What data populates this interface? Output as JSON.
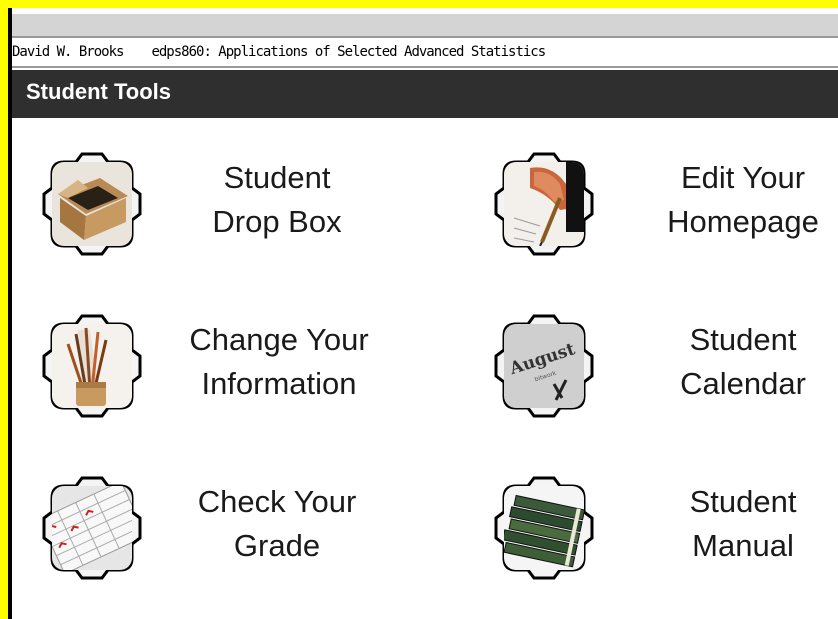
{
  "course_bar": {
    "user_name": "David W. Brooks",
    "course_title": "edps860: Applications of Selected Advanced Statistics"
  },
  "header": {
    "title": "Student Tools"
  },
  "tools": [
    {
      "id": "drop-box",
      "line1": "Student",
      "line2": "Drop Box",
      "icon": "cardboard-box-icon"
    },
    {
      "id": "edit-homepage",
      "line1": "Edit Your",
      "line2": "Homepage",
      "icon": "pen-writing-icon"
    },
    {
      "id": "change-info",
      "line1": "Change Your",
      "line2": "Information",
      "icon": "paintbrushes-icon"
    },
    {
      "id": "calendar",
      "line1": "Student",
      "line2": "Calendar",
      "icon": "calendar-icon"
    },
    {
      "id": "check-grade",
      "line1": "Check Your",
      "line2": "Grade",
      "icon": "gradebook-icon"
    },
    {
      "id": "manual",
      "line1": "Student",
      "line2": "Manual",
      "icon": "books-icon"
    }
  ],
  "calendar_icon_text": {
    "month": "August",
    "sub": "bitwork"
  },
  "colors": {
    "frame": "#ffff00",
    "header_bg": "#2f2f2f",
    "header_text": "#ffffff"
  }
}
